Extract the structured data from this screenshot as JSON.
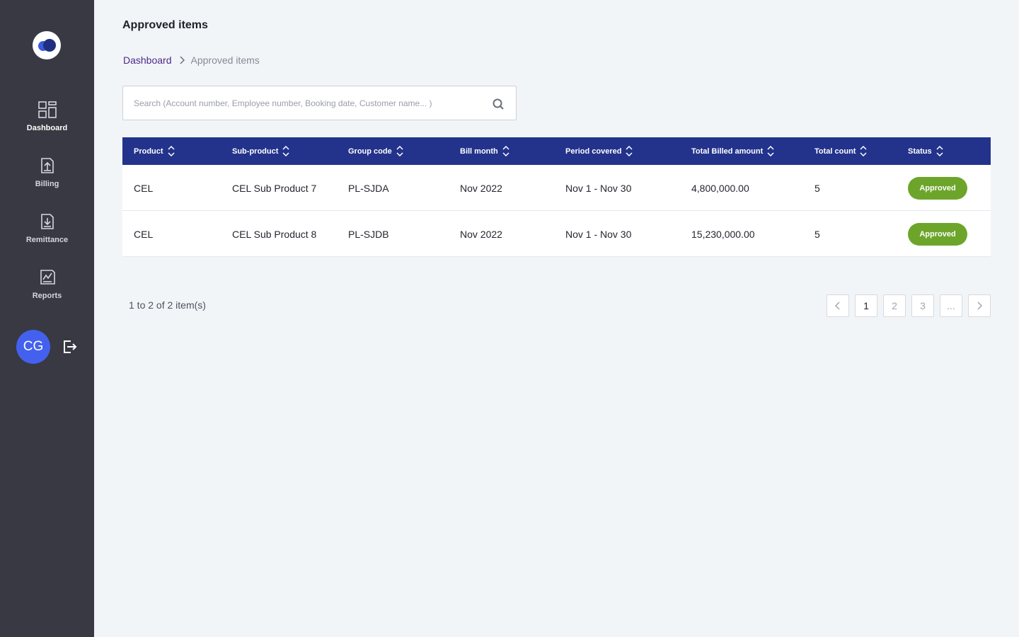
{
  "app": {
    "logo_colors": {
      "light": "#3b5bdb",
      "dark": "#1f2f82"
    }
  },
  "sidebar": {
    "items": [
      {
        "label": "Dashboard",
        "icon": "dashboard-icon"
      },
      {
        "label": "Billing",
        "icon": "billing-upload-icon"
      },
      {
        "label": "Remittance",
        "icon": "remittance-download-icon"
      },
      {
        "label": "Reports",
        "icon": "reports-chart-icon"
      }
    ],
    "user": {
      "initials": "CG",
      "avatar_color": "#4361ee"
    },
    "logout_icon": "logout-icon"
  },
  "header": {
    "title": "Approved items",
    "breadcrumb": {
      "home": "Dashboard",
      "current": "Approved items"
    }
  },
  "search": {
    "placeholder": "Search (Account number, Employee number, Booking date, Customer name... )",
    "value": ""
  },
  "table": {
    "header_color": "#23338c",
    "columns": [
      "Product",
      "Sub-product",
      "Group code",
      "Bill month",
      "Period covered",
      "Total Billed amount",
      "Total count",
      "Status"
    ],
    "rows": [
      {
        "product": "CEL",
        "sub_product": "CEL Sub Product 7",
        "group_code": "PL-SJDA",
        "bill_month": "Nov 2022",
        "period": "Nov 1 - Nov 30",
        "amount": "4,800,000.00",
        "count": "5",
        "status": "Approved"
      },
      {
        "product": "CEL",
        "sub_product": "CEL Sub Product 8",
        "group_code": "PL-SJDB",
        "bill_month": "Nov 2022",
        "period": "Nov 1 - Nov 30",
        "amount": "15,230,000.00",
        "count": "5",
        "status": "Approved"
      }
    ],
    "status_color": "#6da52b"
  },
  "pagination": {
    "summary": "1 to 2 of 2 item(s)",
    "pages": [
      "1",
      "2",
      "3",
      "..."
    ],
    "current": "1"
  }
}
